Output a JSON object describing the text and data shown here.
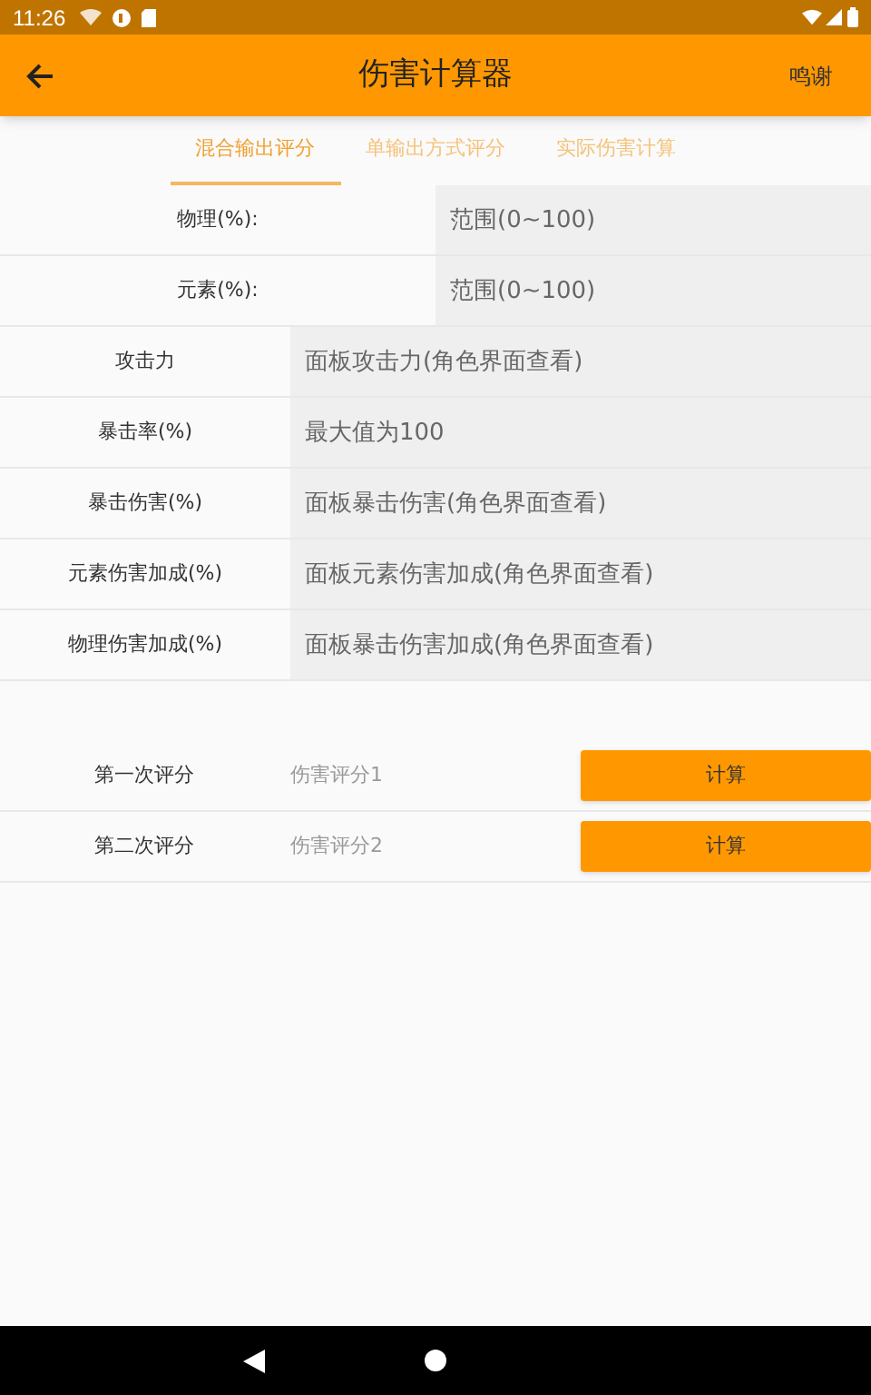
{
  "status_bar": {
    "time": "11:26"
  },
  "app_bar": {
    "title": "伤害计算器",
    "action": "鸣谢"
  },
  "tabs": [
    {
      "label": "混合输出评分",
      "selected": true
    },
    {
      "label": "单输出方式评分",
      "selected": false
    },
    {
      "label": "实际伤害计算",
      "selected": false
    }
  ],
  "ratio_fields": [
    {
      "label": "物理(%):",
      "placeholder": "范围(0~100)"
    },
    {
      "label": "元素(%):",
      "placeholder": "范围(0~100)"
    }
  ],
  "stat_fields": [
    {
      "label": "攻击力",
      "placeholder": "面板攻击力(角色界面查看)"
    },
    {
      "label": "暴击率(%)",
      "placeholder": "最大值为100"
    },
    {
      "label": "暴击伤害(%)",
      "placeholder": "面板暴击伤害(角色界面查看)"
    },
    {
      "label": "元素伤害加成(%)",
      "placeholder": "面板元素伤害加成(角色界面查看)"
    },
    {
      "label": "物理伤害加成(%)",
      "placeholder": "面板暴击伤害加成(角色界面查看)"
    }
  ],
  "scores": [
    {
      "label": "第一次评分",
      "result": "伤害评分1",
      "button": "计算"
    },
    {
      "label": "第二次评分",
      "result": "伤害评分2",
      "button": "计算"
    }
  ]
}
